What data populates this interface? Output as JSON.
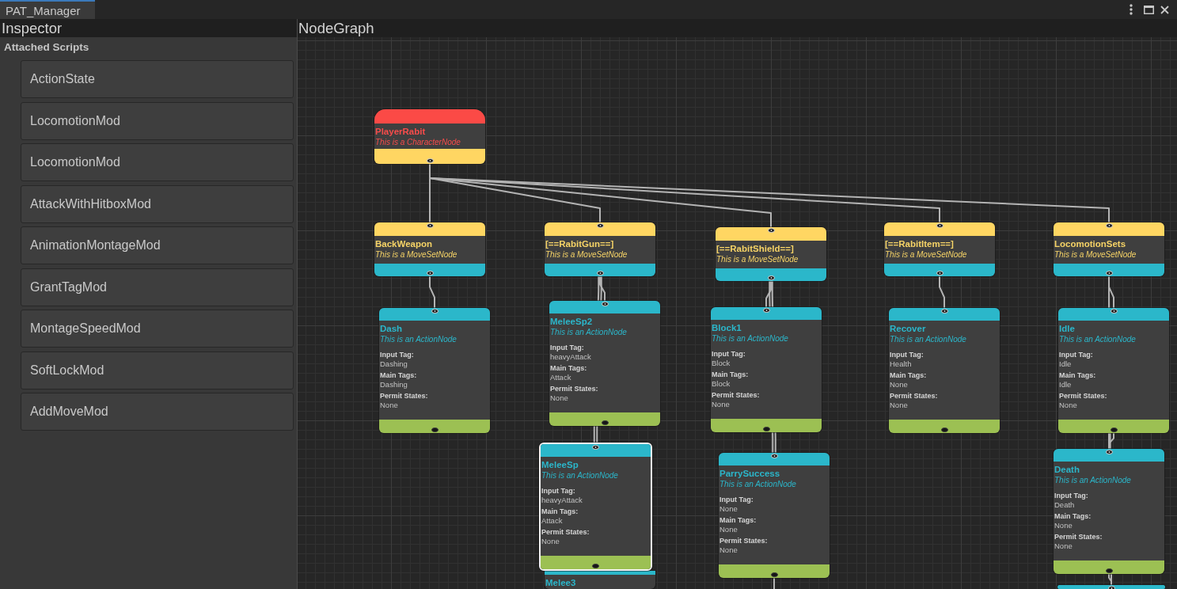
{
  "window": {
    "tabs": [
      {
        "label": "PAT_Manager",
        "selected": true
      }
    ]
  },
  "inspector": {
    "title": "Inspector",
    "section": "Attached Scripts",
    "scripts": [
      "ActionState",
      "LocomotionMod",
      "LocomotionMod",
      "AttackWithHitboxMod",
      "AnimationMontageMod",
      "GrantTagMod",
      "MontageSpeedMod",
      "SoftLockMod",
      "AddMoveMod"
    ]
  },
  "node_graph": {
    "title": "NodeGraph",
    "nodes": [
      {
        "kind": "character",
        "title": "PlayerRabit",
        "subtitle": "This is a CharacterNode",
        "selected": false
      },
      {
        "kind": "moveset",
        "title": "BackWeapon",
        "subtitle": "This is a MoveSetNode",
        "selected": false
      },
      {
        "kind": "moveset",
        "title": "[==RabitGun==]",
        "subtitle": "This is a MoveSetNode",
        "selected": false
      },
      {
        "kind": "moveset",
        "title": "[==RabitShield==]",
        "subtitle": "This is a MoveSetNode",
        "selected": false
      },
      {
        "kind": "moveset",
        "title": "[==RabitItem==]",
        "subtitle": "This is a MoveSetNode",
        "selected": false
      },
      {
        "kind": "moveset",
        "title": "LocomotionSets",
        "subtitle": "This is a MoveSetNode",
        "selected": false
      },
      {
        "kind": "action",
        "title": "Dash",
        "subtitle": "This is an ActionNode",
        "selected": false,
        "fields": [
          {
            "label": "Input Tag:",
            "value": "Dashing"
          },
          {
            "label": "Main Tags:",
            "value": "Dashing"
          },
          {
            "label": "Permit States:",
            "value": "None"
          }
        ]
      },
      {
        "kind": "action",
        "title": "MeleeSp2",
        "subtitle": "This is an ActionNode",
        "selected": false,
        "fields": [
          {
            "label": "Input Tag:",
            "value": "heavyAttack"
          },
          {
            "label": "Main Tags:",
            "value": "Attack"
          },
          {
            "label": "Permit States:",
            "value": "None"
          }
        ]
      },
      {
        "kind": "action",
        "title": "Block1",
        "subtitle": "This is an ActionNode",
        "selected": false,
        "fields": [
          {
            "label": "Input Tag:",
            "value": "Block"
          },
          {
            "label": "Main Tags:",
            "value": "Block"
          },
          {
            "label": "Permit States:",
            "value": "None"
          }
        ]
      },
      {
        "kind": "action",
        "title": "Recover",
        "subtitle": "This is an ActionNode",
        "selected": false,
        "fields": [
          {
            "label": "Input Tag:",
            "value": "Health"
          },
          {
            "label": "Main Tags:",
            "value": "None"
          },
          {
            "label": "Permit States:",
            "value": "None"
          }
        ]
      },
      {
        "kind": "action",
        "title": "Idle",
        "subtitle": "This is an ActionNode",
        "selected": false,
        "fields": [
          {
            "label": "Input Tag:",
            "value": "Idle"
          },
          {
            "label": "Main Tags:",
            "value": "Idle"
          },
          {
            "label": "Permit States:",
            "value": "None"
          }
        ]
      },
      {
        "kind": "action",
        "title": "MeleeSp",
        "subtitle": "This is an ActionNode",
        "selected": true,
        "fields": [
          {
            "label": "Input Tag:",
            "value": "heavyAttack"
          },
          {
            "label": "Main Tags:",
            "value": "Attack"
          },
          {
            "label": "Permit States:",
            "value": "None"
          }
        ]
      },
      {
        "kind": "action",
        "title": "ParrySuccess",
        "subtitle": "This is an ActionNode",
        "selected": false,
        "fields": [
          {
            "label": "Input Tag:",
            "value": "None"
          },
          {
            "label": "Main Tags:",
            "value": "None"
          },
          {
            "label": "Permit States:",
            "value": "None"
          }
        ]
      },
      {
        "kind": "action",
        "title": "Death",
        "subtitle": "This is an ActionNode",
        "selected": false,
        "fields": [
          {
            "label": "Input Tag:",
            "value": "Death"
          },
          {
            "label": "Main Tags:",
            "value": "None"
          },
          {
            "label": "Permit States:",
            "value": "None"
          }
        ]
      },
      {
        "kind": "action",
        "title": "Melee3",
        "selected": false
      },
      {
        "kind": "action",
        "selected": false
      }
    ]
  }
}
